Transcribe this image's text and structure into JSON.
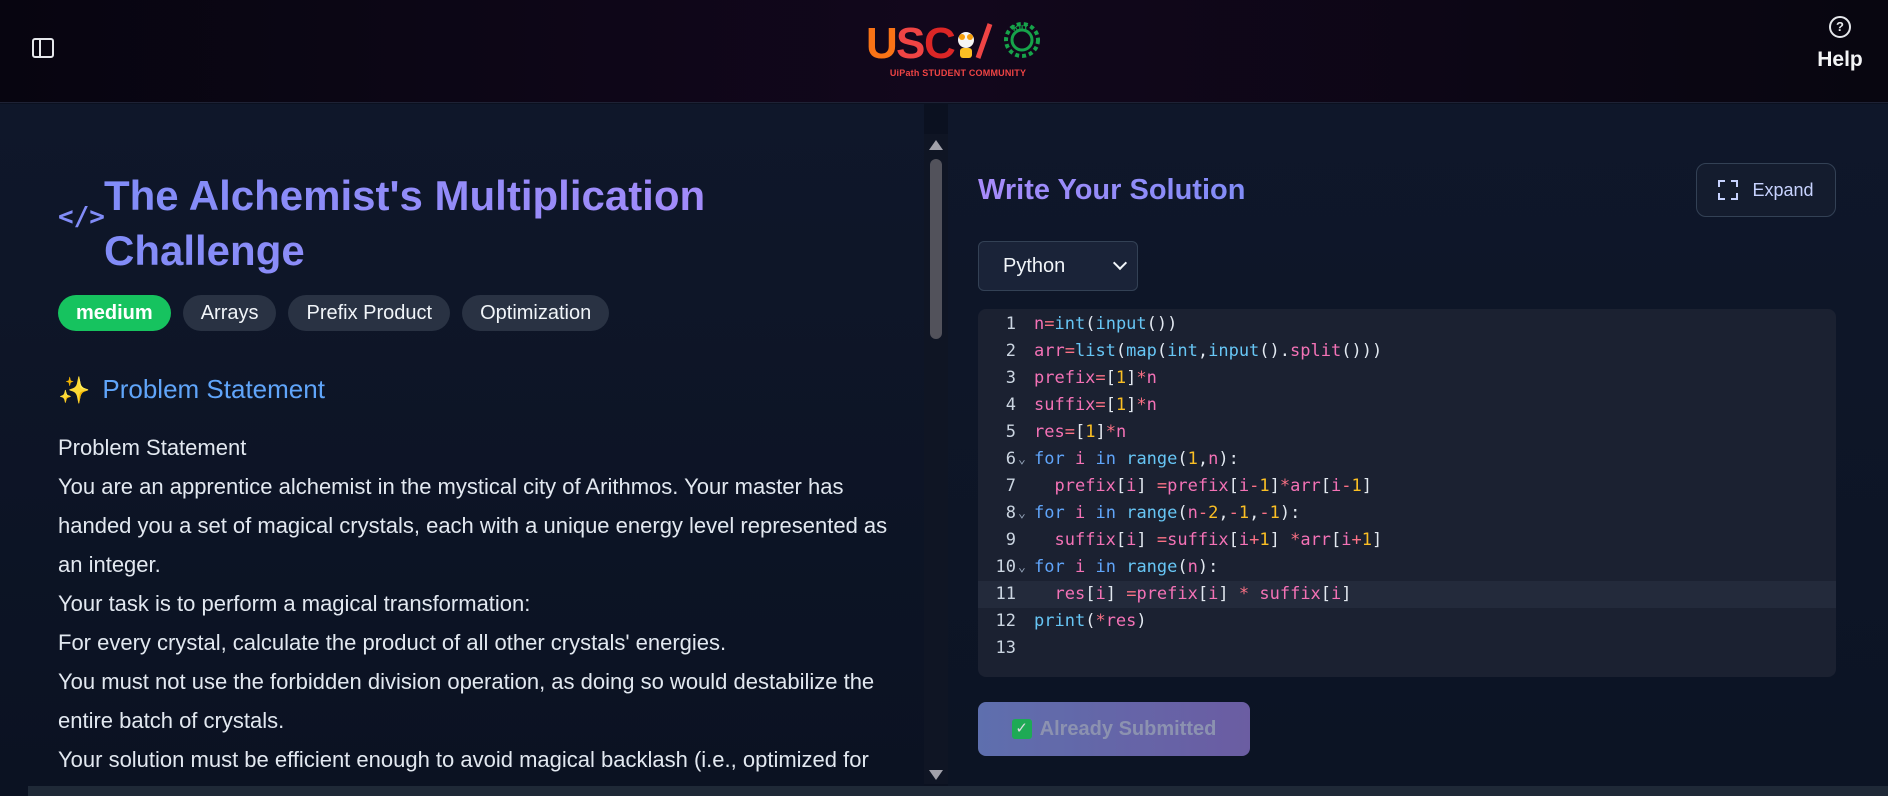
{
  "header": {
    "logo_subtitle": "UiPath STUDENT COMMUNITY",
    "help_label": "Help"
  },
  "problem": {
    "title": "The Alchemist's Multiplication Challenge",
    "difficulty": "medium",
    "tags": [
      "Arrays",
      "Prefix Product",
      "Optimization"
    ],
    "section_title": "Problem Statement",
    "statement_lines": [
      "Problem Statement",
      "You are an apprentice alchemist in the mystical city of Arithmos. Your master has handed you a set of magical crystals, each with a unique energy level represented as an integer.",
      "Your task is to perform a magical transformation:",
      "For every crystal, calculate the product of all other crystals' energies.",
      "You must not use the forbidden division operation, as doing so would destabilize the entire batch of crystals.",
      "Your solution must be efficient enough to avoid magical backlash (i.e., optimized for large inputs)."
    ]
  },
  "solution": {
    "title": "Write Your Solution",
    "expand_label": "Expand",
    "language": "Python",
    "code_lines": [
      "n=int(input())",
      "arr=list(map(int,input().split()))",
      "prefix=[1]*n",
      "suffix=[1]*n",
      "res=[1]*n",
      "for i in range(1,n):",
      "  prefix[i] =prefix[i-1]*arr[i-1]",
      "for i in range(n-2,-1,-1):",
      "  suffix[i] =suffix[i+1] *arr[i+1]",
      "for i in range(n):",
      "  res[i] =prefix[i] * suffix[i]",
      "print(*res)",
      ""
    ],
    "submit_label": "Already Submitted"
  },
  "colors": {
    "difficulty_badge": "#16c35f",
    "accent": "#818cf8",
    "background": "#0b1120"
  }
}
